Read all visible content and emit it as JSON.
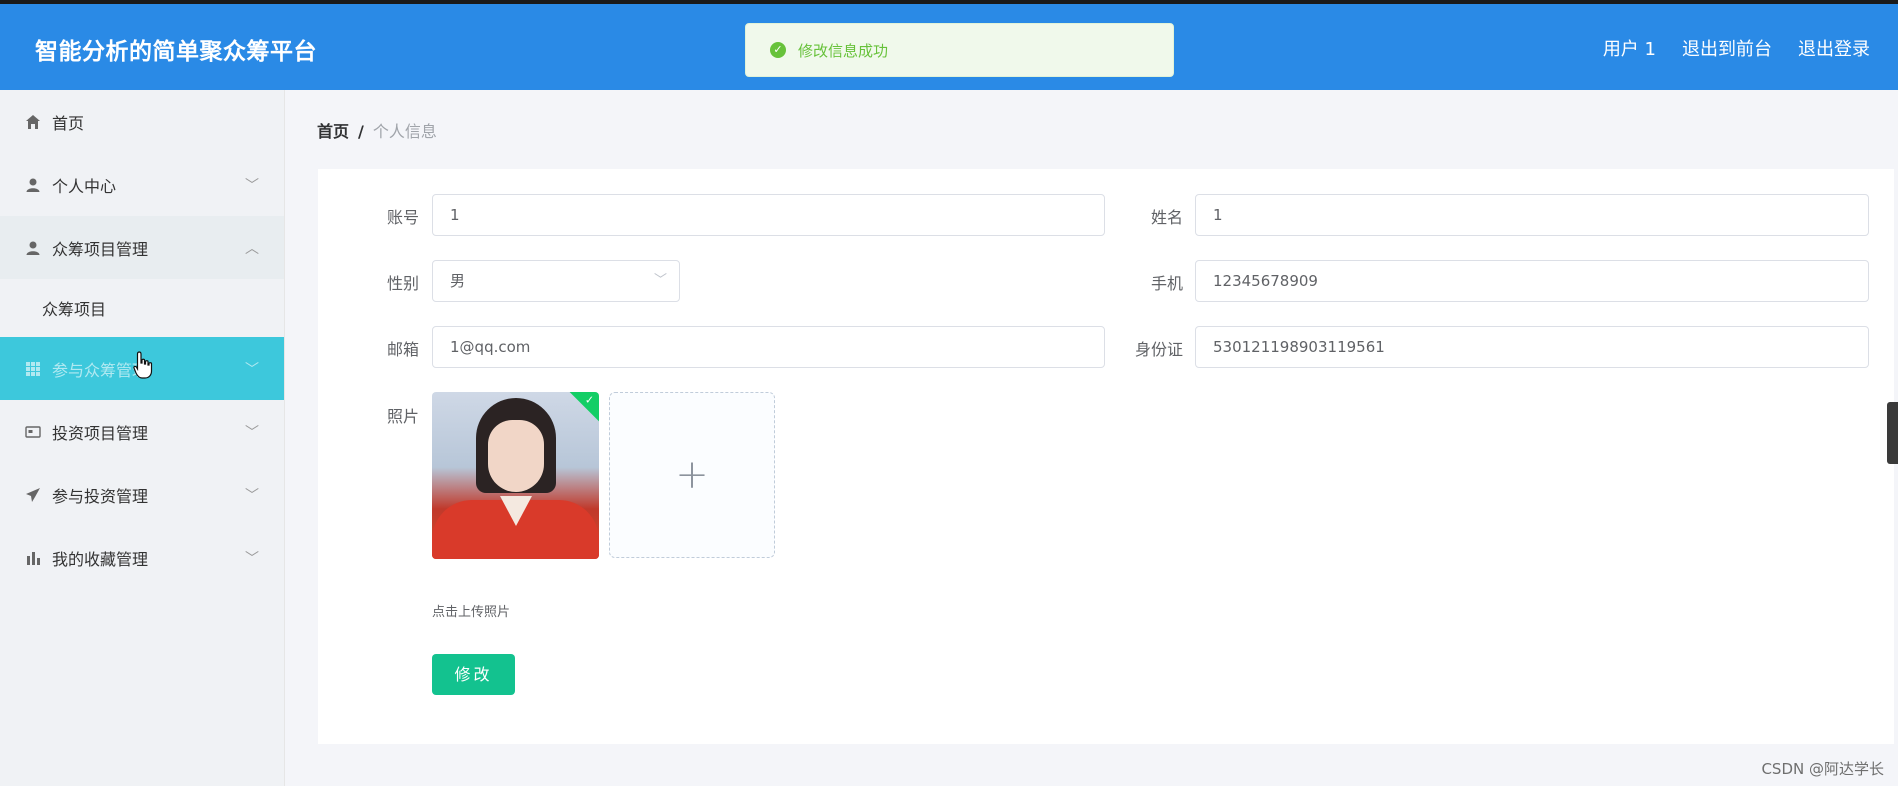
{
  "header": {
    "title": "智能分析的简单聚众筹平台",
    "nav": [
      "用户 1",
      "退出到前台",
      "退出登录"
    ]
  },
  "toast": {
    "message": "修改信息成功",
    "icon": "success-check-icon",
    "color": "#67c23a"
  },
  "sidebar": {
    "items": [
      {
        "label": "首页",
        "icon": "home-icon"
      },
      {
        "label": "个人中心",
        "icon": "user-icon"
      },
      {
        "label": "众筹项目管理",
        "icon": "user-icon"
      },
      {
        "label": "众筹项目",
        "icon": ""
      },
      {
        "label": "参与众筹管理",
        "icon": "grid-icon"
      },
      {
        "label": "投资项目管理",
        "icon": "card-icon"
      },
      {
        "label": "参与投资管理",
        "icon": "send-icon"
      },
      {
        "label": "我的收藏管理",
        "icon": "chart-bar-icon"
      }
    ]
  },
  "breadcrumb": {
    "home": "首页",
    "separator": "/",
    "current": "个人信息"
  },
  "form": {
    "account_label": "账号",
    "account_value": "1",
    "name_label": "姓名",
    "name_value": "1",
    "gender_label": "性别",
    "gender_value": "男",
    "phone_label": "手机",
    "phone_value": "12345678909",
    "email_label": "邮箱",
    "email_value": "1@qq.com",
    "idcard_label": "身份证",
    "idcard_value": "530121198903119561",
    "photo_label": "照片",
    "upload_hint": "点击上传照片",
    "submit_label": "修改"
  },
  "watermark": "CSDN @阿达学长",
  "colors": {
    "header": "#2a8ae6",
    "active_menu": "#3dc8dc",
    "submit": "#13c28f"
  }
}
